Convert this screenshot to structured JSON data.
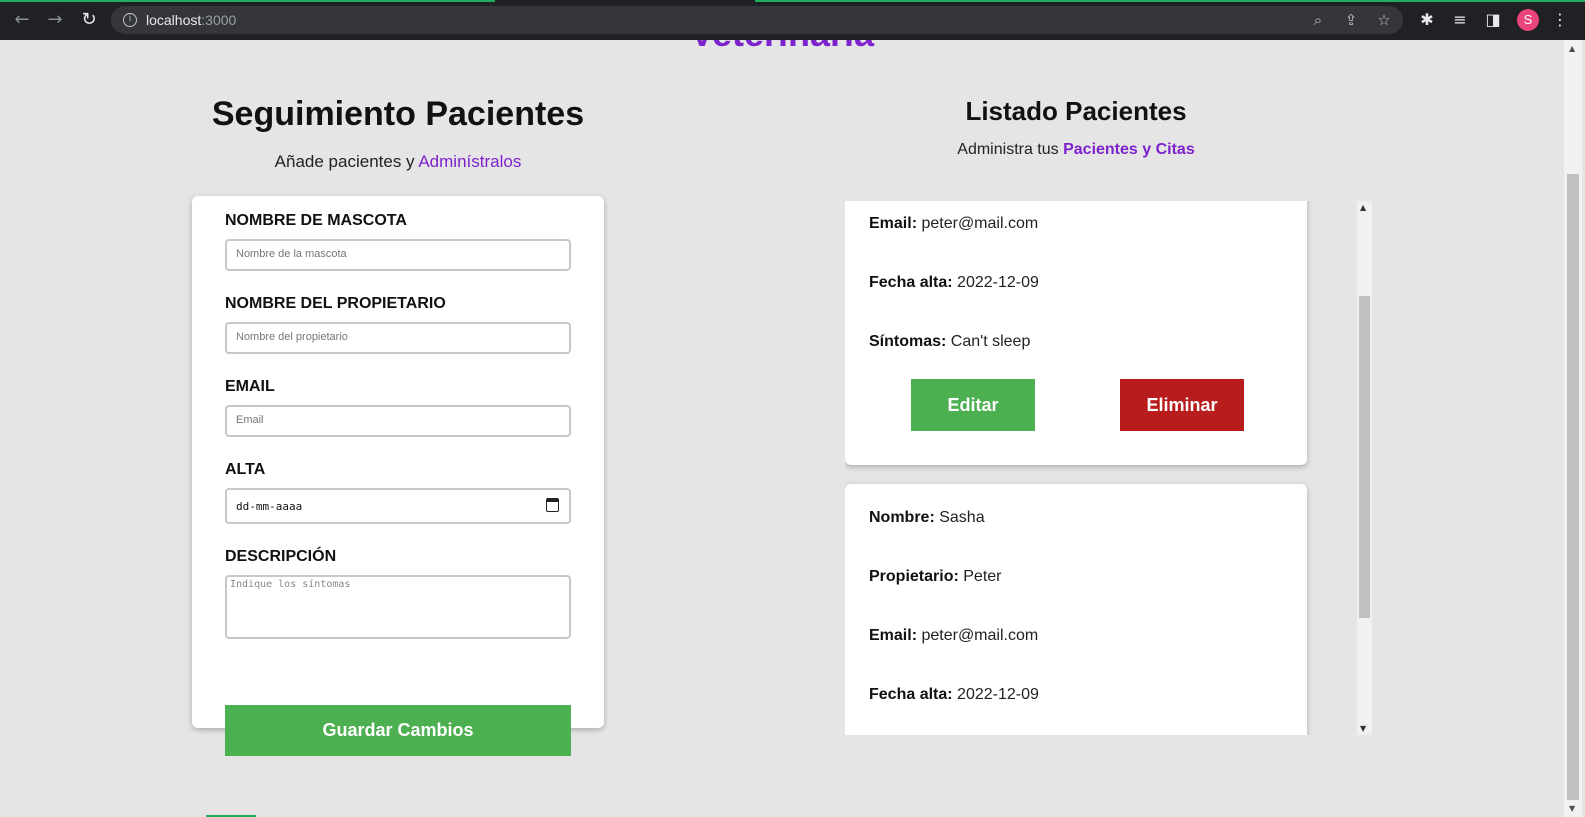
{
  "browser": {
    "url_host": "localhost",
    "url_port": ":3000",
    "profile_initial": "S",
    "icons": [
      "back-icon",
      "forward-icon",
      "reload-icon",
      "info-icon",
      "zoom-icon",
      "share-icon",
      "star-icon",
      "extensions-icon",
      "media-icon",
      "side-panel-icon",
      "menu-icon"
    ]
  },
  "header": {
    "brand": "Veterinaria"
  },
  "form_section": {
    "title": "Seguimiento Pacientes",
    "subtitle_prefix": "Añade pacientes y ",
    "subtitle_accent": "Adminístralos",
    "fields": {
      "pet_name": {
        "label": "NOMBRE DE MASCOTA",
        "placeholder": "Nombre de la mascota",
        "value": ""
      },
      "owner_name": {
        "label": "NOMBRE DEL PROPIETARIO",
        "placeholder": "Nombre del propietario",
        "value": ""
      },
      "email": {
        "label": "EMAIL",
        "placeholder": "Email",
        "value": ""
      },
      "date": {
        "label": "ALTA",
        "placeholder": "dd-mm-aaaa"
      },
      "description": {
        "label": "DESCRIPCIÓN",
        "placeholder": "Indique los síntomas"
      }
    },
    "submit_label": "Guardar Cambios"
  },
  "list_section": {
    "title": "Listado Pacientes",
    "subtitle_prefix": "Administra tus ",
    "subtitle_accent": "Pacientes y Citas",
    "edit_label": "Editar",
    "delete_label": "Eliminar",
    "patients": [
      {
        "email_label": "Email:",
        "email": "peter@mail.com",
        "date_label": "Fecha alta:",
        "date": "2022-12-09",
        "symptoms_label": "Síntomas:",
        "symptoms": "Can't sleep"
      },
      {
        "name_label": "Nombre:",
        "name": "Sasha",
        "owner_label": "Propietario:",
        "owner": "Peter",
        "email_label": "Email:",
        "email": "peter@mail.com",
        "date_label": "Fecha alta:",
        "date": "2022-12-09"
      }
    ]
  },
  "colors": {
    "accent": "#7e22ce",
    "success": "#4caf50",
    "danger": "#b91c1c",
    "background": "#e5e5e5"
  }
}
